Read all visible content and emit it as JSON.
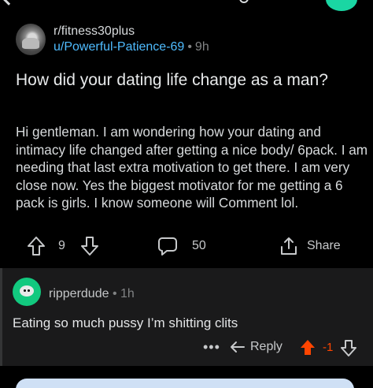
{
  "post": {
    "subreddit": "r/fitness30plus",
    "author": "u/Powerful-Patience-69",
    "separator": "•",
    "age": "9h",
    "title": "How did your dating life change as a man?",
    "body": "Hi gentleman. I am wondering how your dating and intimacy life changed after getting a nice body/ 6pack. I am needing that last extra motivation to get there. I am very close now. Yes the biggest motivator for me getting a 6 pack is girls. I know someone will Comment lol.",
    "score": "9",
    "comments_count": "50",
    "share_label": "Share"
  },
  "comment": {
    "author": "ripperdude",
    "separator": "•",
    "age": "1h",
    "text": "Eating so much pussy I’m shitting clits",
    "more": "•••",
    "reply_label": "Reply",
    "score": "-1"
  },
  "colors": {
    "accent_blue": "#4fbcff",
    "upvote_orange": "#ff4500",
    "comment_bg": "#1a1a1b",
    "avatar_green": "#12c97f"
  },
  "icons": {
    "back": "back-arrow-icon",
    "upvote": "upvote-arrow-icon",
    "downvote": "downvote-arrow-icon",
    "comments": "comment-bubble-icon",
    "share": "share-icon",
    "reply": "reply-arrow-icon",
    "more": "more-dots-icon"
  }
}
